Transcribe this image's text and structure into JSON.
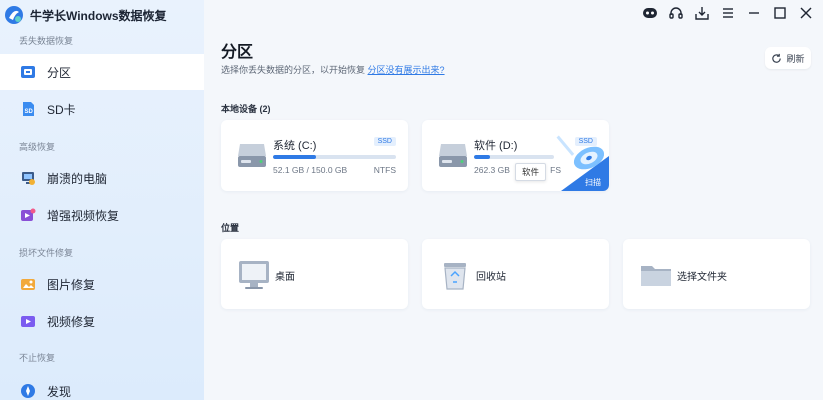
{
  "app": {
    "title": "牛学长Windows数据恢复"
  },
  "sidebar": {
    "sections": [
      {
        "title": "丢失数据恢复"
      },
      {
        "title": "高级恢复"
      },
      {
        "title": "损坏文件修复"
      },
      {
        "title": "不止恢复"
      }
    ],
    "items": [
      {
        "label": "分区",
        "icon": "partition-icon",
        "active": true
      },
      {
        "label": "SD卡",
        "icon": "sd-card-icon"
      },
      {
        "label": "崩溃的电脑",
        "icon": "crashed-pc-icon"
      },
      {
        "label": "增强视频恢复",
        "icon": "video-recovery-icon"
      },
      {
        "label": "图片修复",
        "icon": "photo-repair-icon"
      },
      {
        "label": "视频修复",
        "icon": "video-repair-icon"
      },
      {
        "label": "发现",
        "icon": "discover-icon"
      }
    ]
  },
  "topbar": {
    "icons": [
      "robot-icon",
      "headset-icon",
      "download-icon",
      "menu-icon",
      "minimize-icon",
      "maximize-icon",
      "close-icon"
    ]
  },
  "main": {
    "title": "分区",
    "subtitle": "选择你丢失数据的分区，以开始恢复",
    "subtitle_link": "分区没有展示出来?",
    "refresh_label": "刷新",
    "devices_label": "本地设备 (2)",
    "drives": [
      {
        "name": "系统 (C:)",
        "badge": "SSD",
        "size": "52.1 GB / 150.0 GB",
        "fs": "NTFS",
        "used_fraction": 0.347
      },
      {
        "name": "软件 (D:)",
        "badge": "SSD",
        "size": "262.3 GB",
        "fs": "FS",
        "used_fraction": 0.2,
        "tooltip": "软件",
        "scan_label": "扫描"
      }
    ],
    "locations_label": "位置",
    "locations": [
      {
        "label": "桌面",
        "icon": "desktop-icon"
      },
      {
        "label": "回收站",
        "icon": "recycle-bin-icon"
      },
      {
        "label": "选择文件夹",
        "icon": "folder-icon"
      }
    ]
  },
  "colors": {
    "accent": "#2f7ae5",
    "sidebar_bg": "#e6f0fc"
  }
}
